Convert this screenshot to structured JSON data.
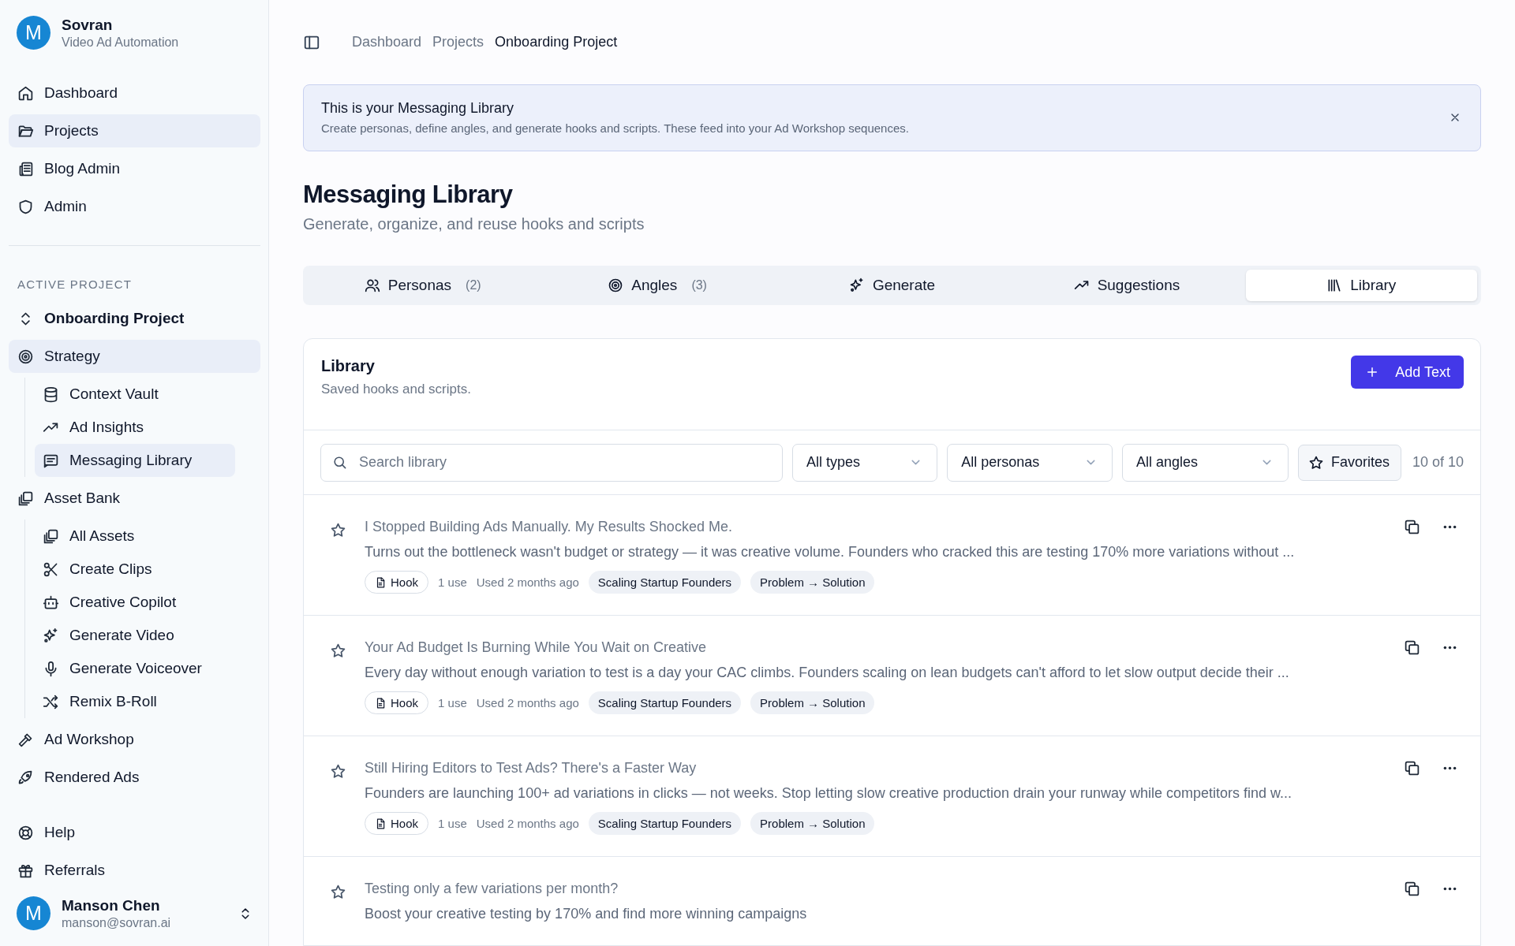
{
  "brand": {
    "avatar": "M",
    "name": "Sovran",
    "subtitle": "Video Ad Automation"
  },
  "nav": [
    {
      "label": "Dashboard",
      "selected": false
    },
    {
      "label": "Projects",
      "selected": true
    },
    {
      "label": "Blog Admin",
      "selected": false
    },
    {
      "label": "Admin",
      "selected": false
    }
  ],
  "active_project": {
    "heading": "ACTIVE PROJECT",
    "project": "Onboarding Project",
    "items": [
      {
        "label": "Strategy",
        "selected": true,
        "children": [
          {
            "label": "Context Vault",
            "selected": false
          },
          {
            "label": "Ad Insights",
            "selected": false
          },
          {
            "label": "Messaging Library",
            "selected": true
          }
        ]
      },
      {
        "label": "Asset Bank",
        "selected": false,
        "children": [
          {
            "label": "All Assets",
            "selected": false
          },
          {
            "label": "Create Clips",
            "selected": false
          },
          {
            "label": "Creative Copilot",
            "selected": false
          },
          {
            "label": "Generate Video",
            "selected": false
          },
          {
            "label": "Generate Voiceover",
            "selected": false
          },
          {
            "label": "Remix B-Roll",
            "selected": false
          }
        ]
      },
      {
        "label": "Ad Workshop",
        "selected": false
      },
      {
        "label": "Rendered Ads",
        "selected": false
      }
    ]
  },
  "footer_nav": [
    {
      "label": "Help",
      "selected": false
    },
    {
      "label": "Referrals",
      "selected": false
    }
  ],
  "user": {
    "avatar": "M",
    "name": "Manson Chen",
    "email": "manson@sovran.ai"
  },
  "breadcrumb": [
    "Dashboard",
    "Projects",
    "Onboarding Project"
  ],
  "banner": {
    "title": "This is your Messaging Library",
    "text": "Create personas, define angles, and generate hooks and scripts. These feed into your Ad Workshop sequences."
  },
  "page": {
    "title": "Messaging Library",
    "subtitle": "Generate, organize, and reuse hooks and scripts"
  },
  "tabs": [
    {
      "label": "Personas",
      "count": "(2)",
      "selected": false
    },
    {
      "label": "Angles",
      "count": "(3)",
      "selected": false
    },
    {
      "label": "Generate",
      "selected": false
    },
    {
      "label": "Suggestions",
      "selected": false
    },
    {
      "label": "Library",
      "selected": true
    }
  ],
  "library": {
    "title": "Library",
    "subtitle": "Saved hooks and scripts.",
    "add_button": "Add Text",
    "search": {
      "placeholder": "Search library"
    },
    "filters": [
      "All types",
      "All personas",
      "All angles"
    ],
    "favorites": {
      "label": "Favorites",
      "selected": false
    },
    "count": "10 of 10",
    "rows": [
      {
        "favorite": false,
        "title": "I Stopped Building Ads Manually. My Results Shocked Me.",
        "body": "Turns out the bottleneck wasn't budget or strategy — it was creative volume. Founders who cracked this are testing 170% more variations without ...",
        "meta": {
          "type": "Hook",
          "uses": "1 use",
          "used": "Used 2 months ago",
          "persona": "Scaling Startup Founders",
          "angle": "Problem → Solution"
        }
      },
      {
        "favorite": false,
        "title": "Your Ad Budget Is Burning While You Wait on Creative",
        "body": "Every day without enough variation to test is a day your CAC climbs. Founders scaling on lean budgets can't afford to let slow output decide their ...",
        "meta": {
          "type": "Hook",
          "uses": "1 use",
          "used": "Used 2 months ago",
          "persona": "Scaling Startup Founders",
          "angle": "Problem → Solution"
        }
      },
      {
        "favorite": false,
        "title": "Still Hiring Editors to Test Ads? There's a Faster Way",
        "body": "Founders are launching 100+ ad variations in clicks — not weeks. Stop letting slow creative production drain your runway while competitors find w...",
        "meta": {
          "type": "Hook",
          "uses": "1 use",
          "used": "Used 2 months ago",
          "persona": "Scaling Startup Founders",
          "angle": "Problem → Solution"
        }
      },
      {
        "favorite": false,
        "title": "Testing only a few variations per month?",
        "body": "Boost your creative testing by 170% and find more winning campaigns"
      }
    ]
  }
}
